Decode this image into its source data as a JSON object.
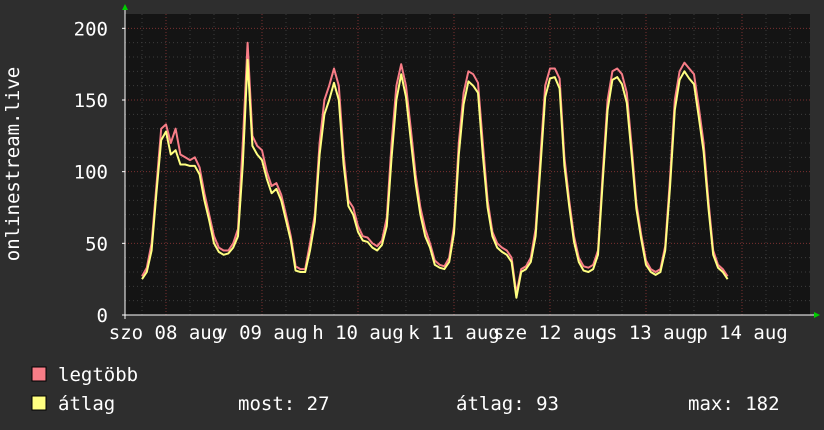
{
  "chart_data": {
    "type": "line",
    "ylabel": "onlinestream.live",
    "ylim": [
      0,
      210
    ],
    "yticks": [
      0,
      50,
      100,
      150,
      200
    ],
    "grid": true,
    "days": [
      {
        "label": "szo 08 aug",
        "x": 0
      },
      {
        "label": "v 09 aug",
        "x": 1
      },
      {
        "label": "h 10 aug",
        "x": 2
      },
      {
        "label": "k 11 aug",
        "x": 3
      },
      {
        "label": "sze 12 aug",
        "x": 4
      },
      {
        "label": "cs 13 aug",
        "x": 5
      },
      {
        "label": "p 14 aug",
        "x": 6
      }
    ],
    "x": [
      -0.25,
      -0.2,
      -0.15,
      -0.1,
      -0.05,
      0.0,
      0.05,
      0.1,
      0.15,
      0.2,
      0.25,
      0.3,
      0.35,
      0.4,
      0.45,
      0.5,
      0.55,
      0.6,
      0.65,
      0.7,
      0.75,
      0.8,
      0.85,
      0.9,
      0.95,
      1.0,
      1.05,
      1.1,
      1.15,
      1.2,
      1.25,
      1.3,
      1.35,
      1.4,
      1.45,
      1.5,
      1.55,
      1.6,
      1.65,
      1.7,
      1.75,
      1.8,
      1.85,
      1.9,
      1.95,
      2.0,
      2.05,
      2.1,
      2.15,
      2.2,
      2.25,
      2.3,
      2.35,
      2.4,
      2.45,
      2.5,
      2.55,
      2.6,
      2.65,
      2.7,
      2.75,
      2.8,
      2.85,
      2.9,
      2.95,
      3.0,
      3.05,
      3.1,
      3.15,
      3.2,
      3.25,
      3.3,
      3.35,
      3.4,
      3.45,
      3.5,
      3.55,
      3.6,
      3.65,
      3.7,
      3.75,
      3.8,
      3.85,
      3.9,
      3.95,
      4.0,
      4.05,
      4.1,
      4.15,
      4.2,
      4.25,
      4.3,
      4.35,
      4.4,
      4.45,
      4.5,
      4.55,
      4.6,
      4.65,
      4.7,
      4.75,
      4.8,
      4.85,
      4.9,
      4.95,
      5.0,
      5.05,
      5.1,
      5.15,
      5.2,
      5.25,
      5.3,
      5.35,
      5.4,
      5.45,
      5.5,
      5.55,
      5.6,
      5.65,
      5.7,
      5.75,
      5.8,
      5.85,
      5.9,
      5.95,
      6.0,
      6.05,
      6.1,
      6.15,
      6.2,
      6.25,
      6.3,
      6.35,
      6.4,
      6.45,
      6.5,
      6.55,
      6.6,
      6.65,
      6.7,
      6.75
    ],
    "series": [
      {
        "name": "legtöbb",
        "color": "#f87d87",
        "values": [
          27,
          33,
          50,
          90,
          130,
          133,
          120,
          130,
          112,
          110,
          108,
          110,
          103,
          85,
          70,
          55,
          47,
          45,
          45,
          50,
          60,
          120,
          190,
          125,
          118,
          115,
          100,
          90,
          92,
          84,
          70,
          55,
          34,
          32,
          32,
          50,
          70,
          120,
          150,
          160,
          172,
          160,
          112,
          80,
          75,
          62,
          55,
          54,
          50,
          48,
          52,
          68,
          120,
          160,
          175,
          160,
          130,
          98,
          75,
          60,
          50,
          38,
          35,
          34,
          40,
          62,
          120,
          155,
          170,
          168,
          162,
          120,
          80,
          58,
          50,
          47,
          45,
          40,
          15,
          32,
          34,
          40,
          60,
          110,
          160,
          172,
          172,
          165,
          110,
          80,
          55,
          40,
          34,
          33,
          35,
          45,
          100,
          150,
          170,
          172,
          168,
          155,
          118,
          78,
          56,
          38,
          32,
          30,
          32,
          48,
          95,
          150,
          170,
          176,
          172,
          168,
          145,
          120,
          80,
          45,
          35,
          32,
          27
        ]
      },
      {
        "name": "átlag",
        "color": "#ffff81",
        "values": [
          25,
          30,
          45,
          85,
          122,
          128,
          112,
          115,
          105,
          105,
          104,
          104,
          98,
          80,
          66,
          50,
          44,
          42,
          43,
          47,
          55,
          105,
          178,
          118,
          112,
          108,
          95,
          85,
          88,
          80,
          66,
          52,
          31,
          30,
          30,
          45,
          65,
          112,
          140,
          150,
          162,
          150,
          105,
          76,
          70,
          58,
          52,
          51,
          47,
          45,
          49,
          62,
          110,
          150,
          168,
          152,
          122,
          92,
          70,
          55,
          47,
          35,
          33,
          32,
          37,
          57,
          112,
          147,
          163,
          160,
          155,
          112,
          75,
          55,
          47,
          44,
          42,
          37,
          12,
          30,
          32,
          37,
          55,
          103,
          152,
          165,
          166,
          158,
          104,
          76,
          51,
          37,
          31,
          30,
          32,
          42,
          94,
          143,
          164,
          166,
          161,
          148,
          112,
          74,
          53,
          35,
          30,
          28,
          30,
          45,
          89,
          143,
          164,
          170,
          165,
          161,
          138,
          114,
          75,
          42,
          33,
          30,
          25
        ]
      }
    ],
    "legend": {
      "items": [
        "legtöbb",
        "átlag"
      ],
      "stats": {
        "most": "most: 27",
        "atlag": "átlag: 93",
        "max": "max: 182"
      }
    }
  }
}
